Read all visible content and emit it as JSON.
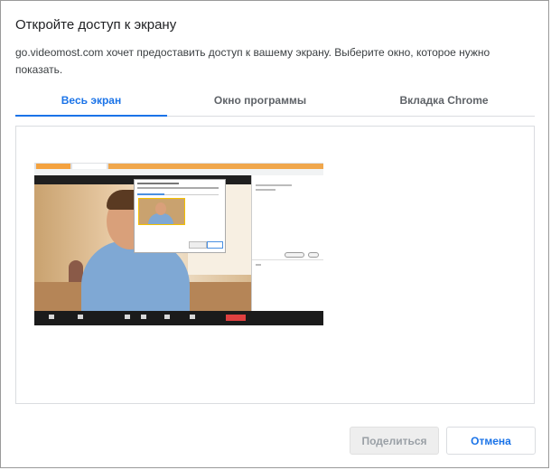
{
  "dialog": {
    "title": "Откройте доступ к экрану",
    "description": "go.videomost.com хочет предоставить доступ к вашему экрану. Выберите окно, которое нужно показать."
  },
  "tabs": [
    {
      "label": "Весь экран",
      "active": true
    },
    {
      "label": "Окно программы",
      "active": false
    },
    {
      "label": "Вкладка Chrome",
      "active": false
    }
  ],
  "preview": {
    "thumbnail": "screen-preview-thumbnail"
  },
  "buttons": {
    "share_label": "Поделиться",
    "cancel_label": "Отмена"
  },
  "colors": {
    "accent": "#1a73e8",
    "tab_inactive": "#5f6368",
    "share_disabled_bg": "#eeeeee"
  }
}
